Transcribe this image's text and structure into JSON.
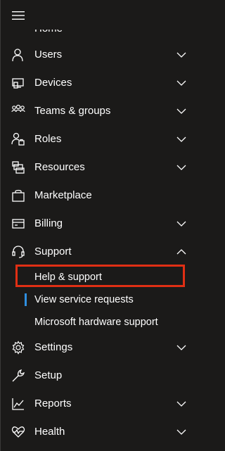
{
  "nav": {
    "cut_item": "Home",
    "items": [
      {
        "label": "Users",
        "icon": "user-icon",
        "chevron": "down"
      },
      {
        "label": "Devices",
        "icon": "devices-icon",
        "chevron": "down"
      },
      {
        "label": "Teams & groups",
        "icon": "group-icon",
        "chevron": "down"
      },
      {
        "label": "Roles",
        "icon": "role-icon",
        "chevron": "down"
      },
      {
        "label": "Resources",
        "icon": "resources-icon",
        "chevron": "down"
      },
      {
        "label": "Marketplace",
        "icon": "shopping-bag-icon",
        "chevron": ""
      },
      {
        "label": "Billing",
        "icon": "credit-card-icon",
        "chevron": "down"
      },
      {
        "label": "Support",
        "icon": "headset-icon",
        "chevron": "up"
      },
      {
        "label": "Settings",
        "icon": "gear-icon",
        "chevron": "down"
      },
      {
        "label": "Setup",
        "icon": "wrench-icon",
        "chevron": ""
      },
      {
        "label": "Reports",
        "icon": "line-chart-icon",
        "chevron": "down"
      },
      {
        "label": "Health",
        "icon": "heart-pulse-icon",
        "chevron": "down"
      }
    ],
    "support_sub": [
      {
        "label": "Help & support"
      },
      {
        "label": "View service requests"
      },
      {
        "label": "Microsoft hardware support"
      }
    ]
  },
  "colors": {
    "background": "#1b1a19",
    "text": "#ffffff",
    "highlight": "#e02f14",
    "active_indicator": "#2f8fe0"
  }
}
